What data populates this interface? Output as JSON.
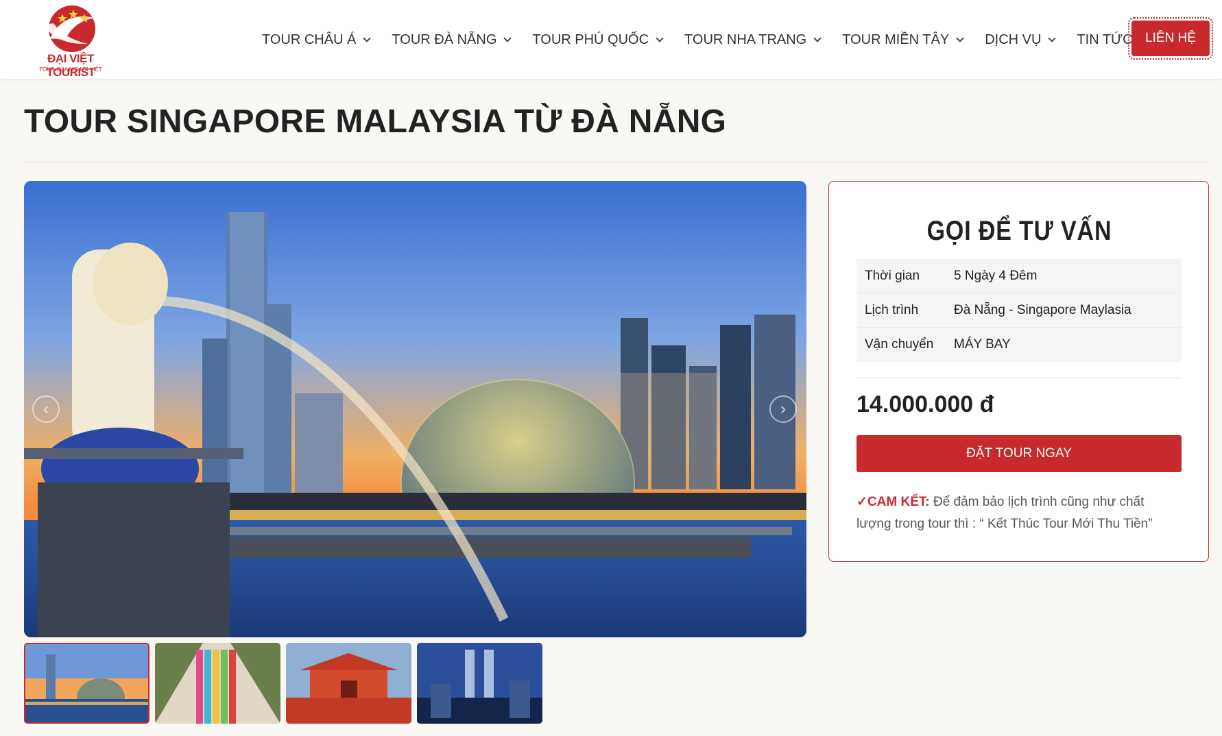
{
  "brand": {
    "name": "ĐẠI VIỆT TOURIST",
    "tagline": "TOUR CỦA NGƯỜI VIỆT"
  },
  "nav": {
    "items": [
      {
        "label": "TOUR CHÂU Á"
      },
      {
        "label": "TOUR ĐÀ NẴNG"
      },
      {
        "label": "TOUR PHÚ QUỐC"
      },
      {
        "label": "TOUR NHA TRANG"
      },
      {
        "label": "TOUR MIỀN TÂY"
      },
      {
        "label": "DỊCH VỤ"
      },
      {
        "label": "TIN TỨC"
      }
    ],
    "contact_label": "LIÊN HỆ"
  },
  "page": {
    "title": "TOUR SINGAPORE MALAYSIA TỪ ĐÀ NẴNG"
  },
  "gallery": {
    "prev_icon": "chevron-left-icon",
    "next_icon": "chevron-right-icon",
    "thumbnails": [
      "singapore-marina-bay",
      "batu-caves-stairs",
      "chinese-temple",
      "petronas-towers"
    ]
  },
  "sidebar": {
    "title": "GỌI ĐỂ TƯ VẤN",
    "info": [
      {
        "label": "Thời gian",
        "value": "5 Ngày 4 Đêm"
      },
      {
        "label": "Lịch trình",
        "value": "Đà Nẵng - Singapore Maylasia"
      },
      {
        "label": "Vận chuyển",
        "value": "MÁY BAY"
      }
    ],
    "price": "14.000.000 đ",
    "book_label": "ĐẶT TOUR NGAY",
    "commit_label": "✓CAM KẾT:",
    "commit_text": " Để đảm bảo lịch trình cũng như chất lượng trong tour thì : “ Kết Thúc Tour Mới Thu Tiền”"
  },
  "colors": {
    "accent": "#c8292c",
    "background": "#faf8f5"
  }
}
